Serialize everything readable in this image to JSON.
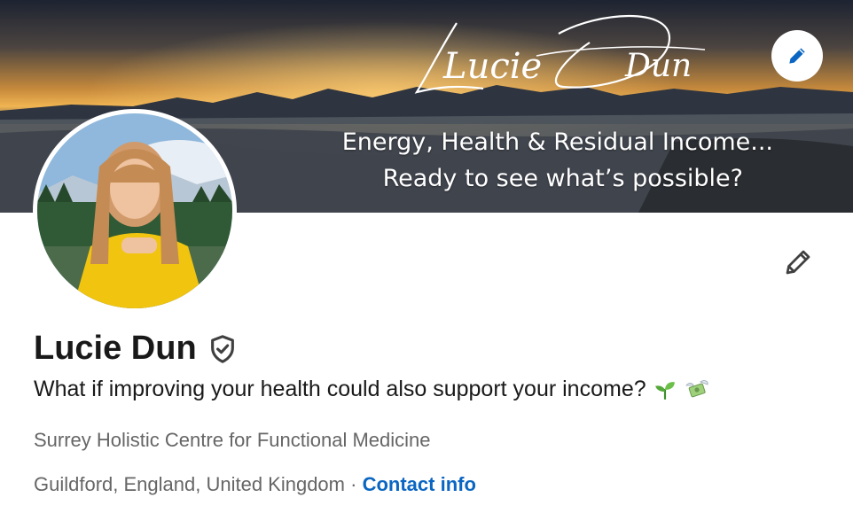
{
  "banner": {
    "signature_first": "Lucie",
    "signature_last": "Dun",
    "line1": "Energy, Health & Residual Income...",
    "line2": "Ready to see what’s possible?"
  },
  "profile": {
    "name": "Lucie Dun",
    "headline": "What if improving your health could also support your income?",
    "organization": "Surrey Holistic Centre for Functional Medicine",
    "location": "Guildford, England, United Kingdom",
    "separator": "·",
    "contact_label": "Contact info"
  },
  "icons": {
    "edit_banner": "pencil-icon",
    "edit_profile": "pencil-icon",
    "verified": "verified-shield-icon",
    "emoji_1": "seedling-emoji",
    "emoji_2": "money-with-wings-emoji"
  },
  "colors": {
    "link": "#0a66c2",
    "text_primary": "#191919",
    "text_secondary": "#666666"
  }
}
